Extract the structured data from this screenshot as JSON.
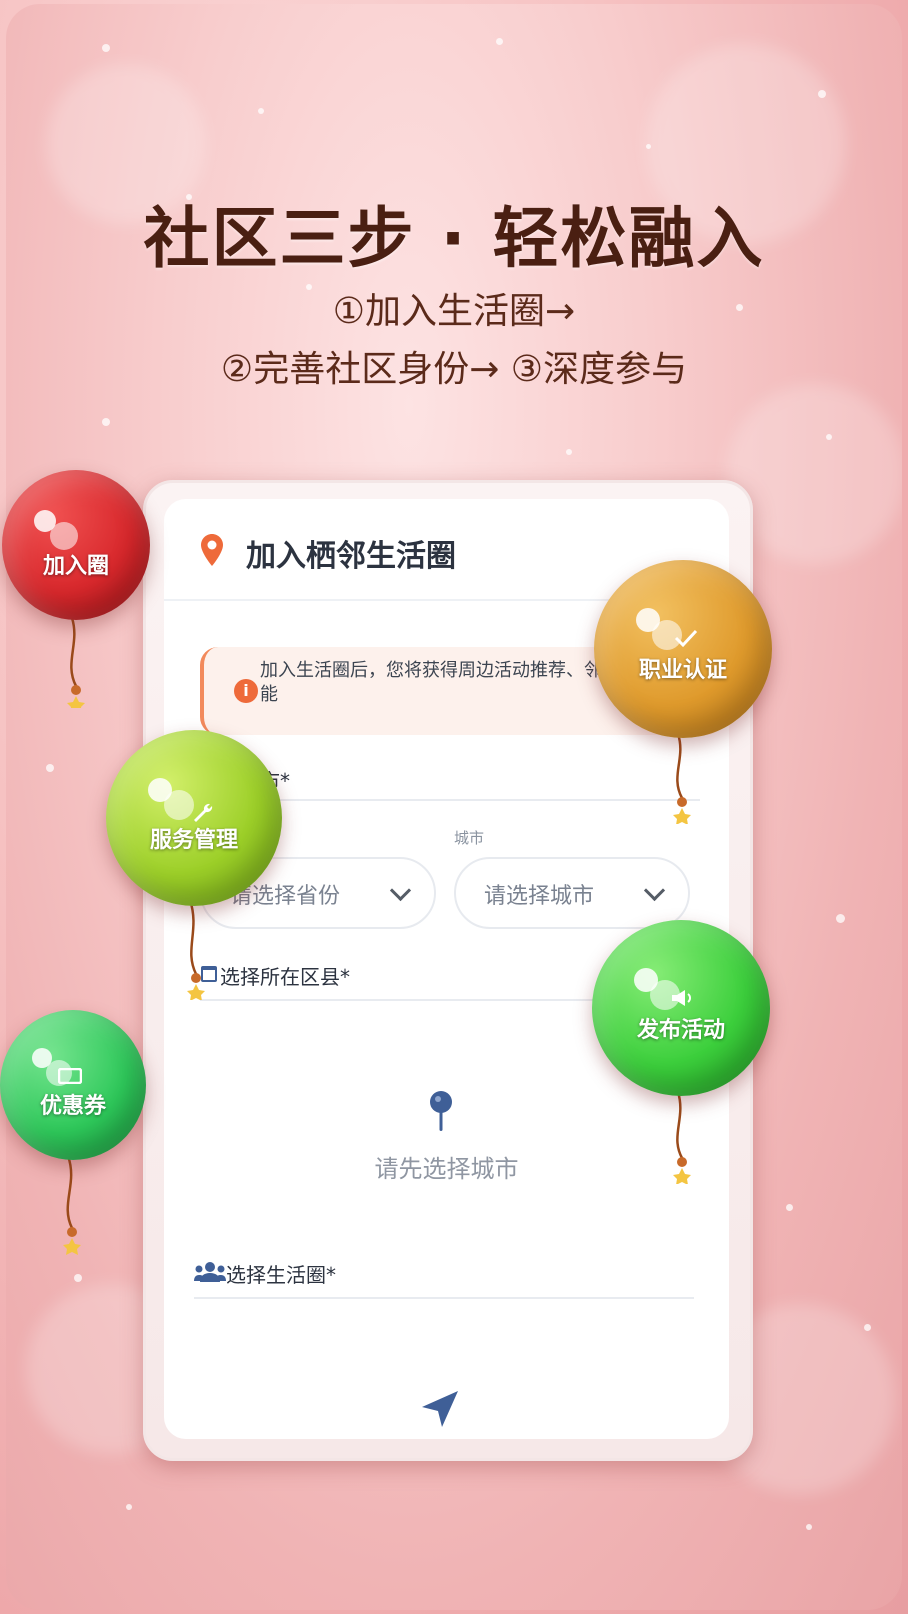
{
  "headline": "社区三步 · 轻松融入",
  "steps": {
    "line1": "①加入生活圈→",
    "line2": "②完善社区身份→ ③深度参与"
  },
  "card": {
    "title": "加入栖邻生活圈",
    "notice": "加入生活圈后，您将获得周边活动推荐、邻里互动功能",
    "province_section_label": "所在省市*",
    "city_label": "城市",
    "province_placeholder": "请选择省份",
    "city_placeholder": "请选择城市",
    "district_label": "选择所在区县*",
    "empty_state": "请先选择城市",
    "circle_label": "选择生活圈*"
  },
  "balloons": {
    "join": {
      "label": "加入圈",
      "color": "#d8282c"
    },
    "service": {
      "label": "服务管理",
      "color": "#9ccf28"
    },
    "coupon": {
      "label": "优惠券",
      "color": "#2ec85a"
    },
    "career": {
      "label": "职业认证",
      "color": "#df9a2c"
    },
    "publish": {
      "label": "发布活动",
      "color": "#3ccf3c"
    }
  },
  "colors": {
    "accent_orange": "#ee6a3a",
    "icon_blue": "#3f5f97"
  }
}
